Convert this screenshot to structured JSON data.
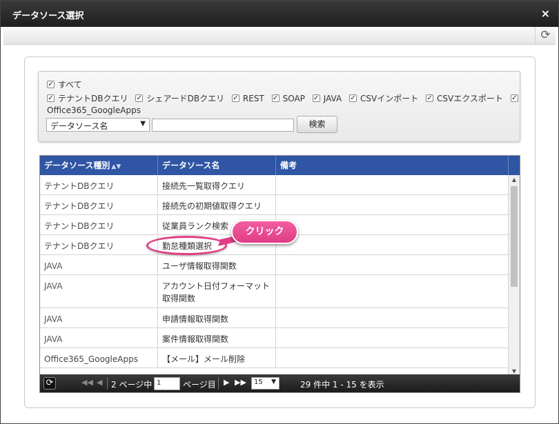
{
  "dialog": {
    "title": "データソース選択",
    "close_icon": "×",
    "refresh_icon": "⟳"
  },
  "filters": {
    "all_label": "すべて",
    "options": [
      {
        "label": "テナントDBクエリ",
        "checked": true
      },
      {
        "label": "シェアードDBクエリ",
        "checked": true
      },
      {
        "label": "REST",
        "checked": true
      },
      {
        "label": "SOAP",
        "checked": true
      },
      {
        "label": "JAVA",
        "checked": true
      },
      {
        "label": "CSVインポート",
        "checked": true
      },
      {
        "label": "CSVエクスポート",
        "checked": true
      },
      {
        "label": "Office365_GoogleApps",
        "checked": true
      }
    ],
    "search_field_selected": "データソース名",
    "search_value": "",
    "search_button": "検索"
  },
  "grid": {
    "columns": [
      "データソース種別",
      "データソース名",
      "備考"
    ],
    "rows": [
      {
        "type": "テナントDBクエリ",
        "name": "接続先一覧取得クエリ",
        "note": ""
      },
      {
        "type": "テナントDBクエリ",
        "name": "接続先の初期値取得クエリ",
        "note": ""
      },
      {
        "type": "テナントDBクエリ",
        "name": "従業員ランク検索",
        "note": ""
      },
      {
        "type": "テナントDBクエリ",
        "name": "勤怠種類選択",
        "note": ""
      },
      {
        "type": "JAVA",
        "name": "ユーザ情報取得関数",
        "note": ""
      },
      {
        "type": "JAVA",
        "name": "アカウント日付フォーマット取得関数",
        "note": ""
      },
      {
        "type": "JAVA",
        "name": "申請情報取得関数",
        "note": ""
      },
      {
        "type": "JAVA",
        "name": "案件情報取得関数",
        "note": ""
      },
      {
        "type": "Office365_GoogleApps",
        "name": "【メール】メール削除",
        "note": ""
      }
    ]
  },
  "pager": {
    "page_label_prefix": "2 ページ中",
    "current_page": "1",
    "page_label_suffix": "ページ目",
    "per_page": "15",
    "summary": "29 件中 1 - 15 を表示"
  },
  "annotation": {
    "callout_text": "クリック"
  },
  "colors": {
    "header_blue": "#2f55a4",
    "callout_pink": "#e23d86",
    "pager_dark": "#262626"
  }
}
